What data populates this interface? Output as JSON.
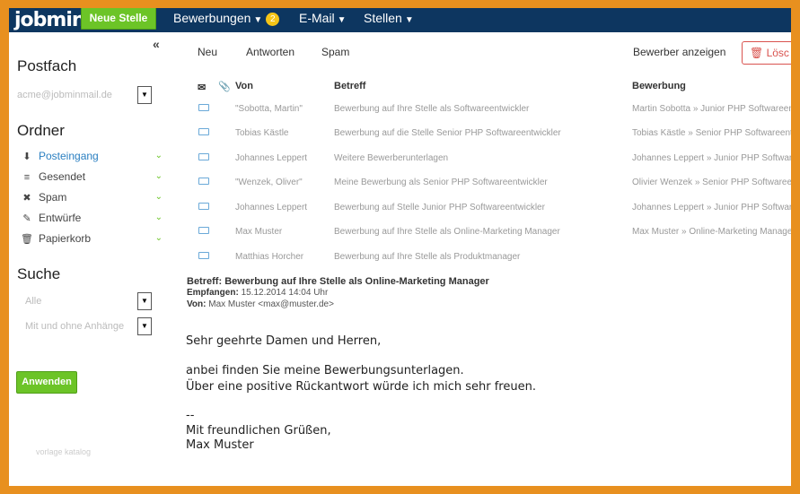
{
  "header": {
    "logo": "jobmin",
    "new_button": "Neue Stelle",
    "nav": [
      {
        "label": "Bewerbungen",
        "badge": "2"
      },
      {
        "label": "E-Mail"
      },
      {
        "label": "Stellen"
      }
    ]
  },
  "sidebar": {
    "mailbox_title": "Postfach",
    "account": "acme@jobminmail.de",
    "folders_title": "Ordner",
    "folders": [
      {
        "label": "Posteingang",
        "icon": "inbox-icon"
      },
      {
        "label": "Gesendet",
        "icon": "sent-icon"
      },
      {
        "label": "Spam",
        "icon": "spam-icon"
      },
      {
        "label": "Entwürfe",
        "icon": "pencil-icon"
      },
      {
        "label": "Papierkorb",
        "icon": "trash-icon"
      }
    ],
    "search_title": "Suche",
    "filter_all": "Alle",
    "filter_attachments": "Mit und ohne Anhänge",
    "apply_button": "Anwenden",
    "watermark": "vorlage katalog"
  },
  "toolbar": {
    "new": "Neu",
    "reply": "Antworten",
    "spam": "Spam",
    "show_applicant": "Bewerber anzeigen",
    "delete": "Lösc"
  },
  "table": {
    "headers": {
      "from": "Von",
      "subject": "Betreff",
      "application": "Bewerbung"
    },
    "rows": [
      {
        "from": "\"Sobotta, Martin\"",
        "subject": "Bewerbung auf Ihre Stelle als Softwareentwickler",
        "application": "Martin Sobotta » Junior PHP Softwareentwickler"
      },
      {
        "from": "Tobias Kästle",
        "subject": "Bewerbung auf die Stelle Senior PHP Softwareentwickler",
        "application": "Tobias Kästle » Senior PHP Softwareentwickler"
      },
      {
        "from": "Johannes Leppert",
        "subject": "Weitere Bewerberunterlagen",
        "application": "Johannes Leppert » Junior PHP Softwareentwickler"
      },
      {
        "from": "\"Wenzek, Oliver\"",
        "subject": "Meine Bewerbung als Senior PHP Softwareentwickler",
        "application": "Olivier Wenzek » Senior PHP Softwareentwickler"
      },
      {
        "from": "Johannes Leppert",
        "subject": "Bewerbung auf Stelle Junior PHP Softwareentwickler",
        "application": "Johannes Leppert » Junior PHP Softwareentwickler"
      },
      {
        "from": "Max Muster",
        "subject": "Bewerbung auf Ihre Stelle als Online-Marketing Manager",
        "application": "Max Muster » Online-Marketing Manager"
      },
      {
        "from": "Matthias Horcher",
        "subject": "Bewerbung auf Ihre Stelle als Produktmanager",
        "application": ""
      }
    ]
  },
  "preview": {
    "subject_label": "Betreff:",
    "subject": "Bewerbung auf Ihre Stelle als Online-Marketing Manager",
    "received_label": "Empfangen:",
    "received": "15.12.2014 14:04 Uhr",
    "from_label": "Von:",
    "from": "Max Muster <max@muster.de>",
    "greeting": "Sehr geehrte Damen und Herren,",
    "line1": "anbei finden Sie meine Bewerbungsunterlagen.",
    "line2": "Über eine positive Rückantwort würde ich mich sehr freuen.",
    "sep": "--",
    "closing": "Mit freundlichen Grüßen,",
    "signature": "Max Muster"
  }
}
